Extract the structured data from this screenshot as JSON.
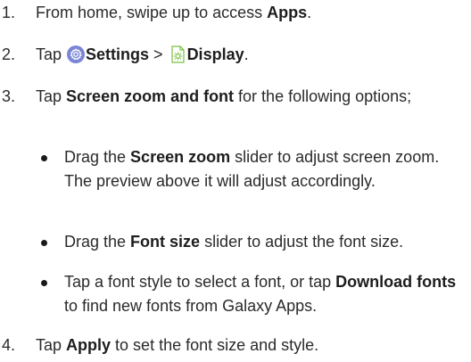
{
  "steps": [
    {
      "num": "1.",
      "pre": "From home, swipe up to access ",
      "bold": "Apps",
      "post": "."
    },
    {
      "num": "2.",
      "tap": "Tap ",
      "settings_icon": "settings-gear-icon",
      "settings": "Settings",
      "sep": " > ",
      "display_icon": "display-brightness-icon",
      "display": "Display",
      "end": "."
    },
    {
      "num": "3.",
      "tap": "Tap ",
      "bold": "Screen zoom and font",
      "post": " for the following options;"
    },
    {
      "num": "4.",
      "tap": "Tap ",
      "bold": "Apply",
      "post": " to set the font size and style."
    }
  ],
  "bullets": [
    {
      "pre": "Drag the ",
      "bold": "Screen zoom",
      "post": " slider to adjust screen zoom. The preview above it will adjust accordingly."
    },
    {
      "pre": "Drag the ",
      "bold": "Font size",
      "post": " slider to adjust the font size."
    },
    {
      "pre": "Tap a font style to select a font, or tap ",
      "bold": "Download fonts",
      "post": " to find new fonts from Galaxy Apps."
    }
  ],
  "colors": {
    "settings_icon": "#7a86d6",
    "display_icon": "#7ac143"
  }
}
